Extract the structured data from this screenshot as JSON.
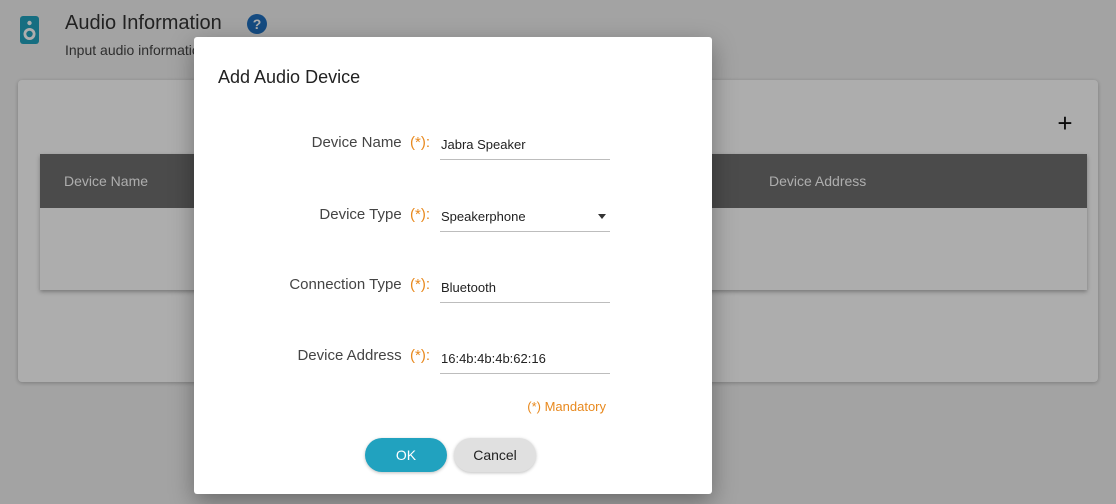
{
  "page": {
    "title": "Audio Information",
    "subtitle": "Input audio information",
    "header_icon": "speaker-icon",
    "help_icon": "question-mark-icon",
    "accent_color": "#21a2bf",
    "help_color": "#1f6fbf"
  },
  "table": {
    "add_icon": "+",
    "columns": [
      "Device Name",
      "Device Address"
    ],
    "header_color": "#6f6f6f"
  },
  "dialog": {
    "title": "Add Audio Device",
    "required_marker": "(*):",
    "required_color": "#e8891e",
    "fields": {
      "device_name": {
        "label": "Device Name",
        "value": "Jabra Speaker"
      },
      "device_type": {
        "label": "Device Type",
        "value": "Speakerphone"
      },
      "connection_type": {
        "label": "Connection Type",
        "value": "Bluetooth"
      },
      "device_address": {
        "label": "Device Address",
        "value": "16:4b:4b:4b:62:16"
      }
    },
    "mandatory_note": "(*) Mandatory",
    "ok_label": "OK",
    "cancel_label": "Cancel"
  }
}
